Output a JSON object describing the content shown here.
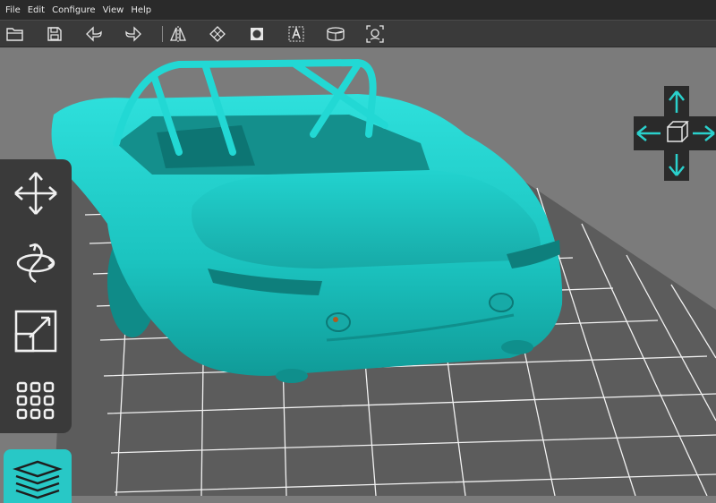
{
  "menu": {
    "items": [
      "File",
      "Edit",
      "Configure",
      "View",
      "Help"
    ]
  },
  "toolbar": {
    "tools": [
      "open-icon",
      "save-icon",
      "undo-icon",
      "redo-icon",
      "mirror-icon",
      "repair-icon",
      "solid-view-icon",
      "text-icon",
      "cut-icon",
      "camera-icon"
    ]
  },
  "left_toolbar": {
    "tools": [
      "move-icon",
      "rotate-icon",
      "scale-icon",
      "arrange-icon",
      "layers-icon"
    ],
    "active": "layers-icon"
  },
  "view_cube": {
    "icons": [
      "arrow-up-icon",
      "arrow-left-icon",
      "cube-icon",
      "arrow-right-icon",
      "arrow-down-icon"
    ]
  },
  "colors": {
    "model": "#1fd0cc",
    "accent": "#28c8c6",
    "grid_line": "#f2f2f2",
    "bed": "#5c5c5c",
    "toolbar": "#3a3a3a"
  }
}
